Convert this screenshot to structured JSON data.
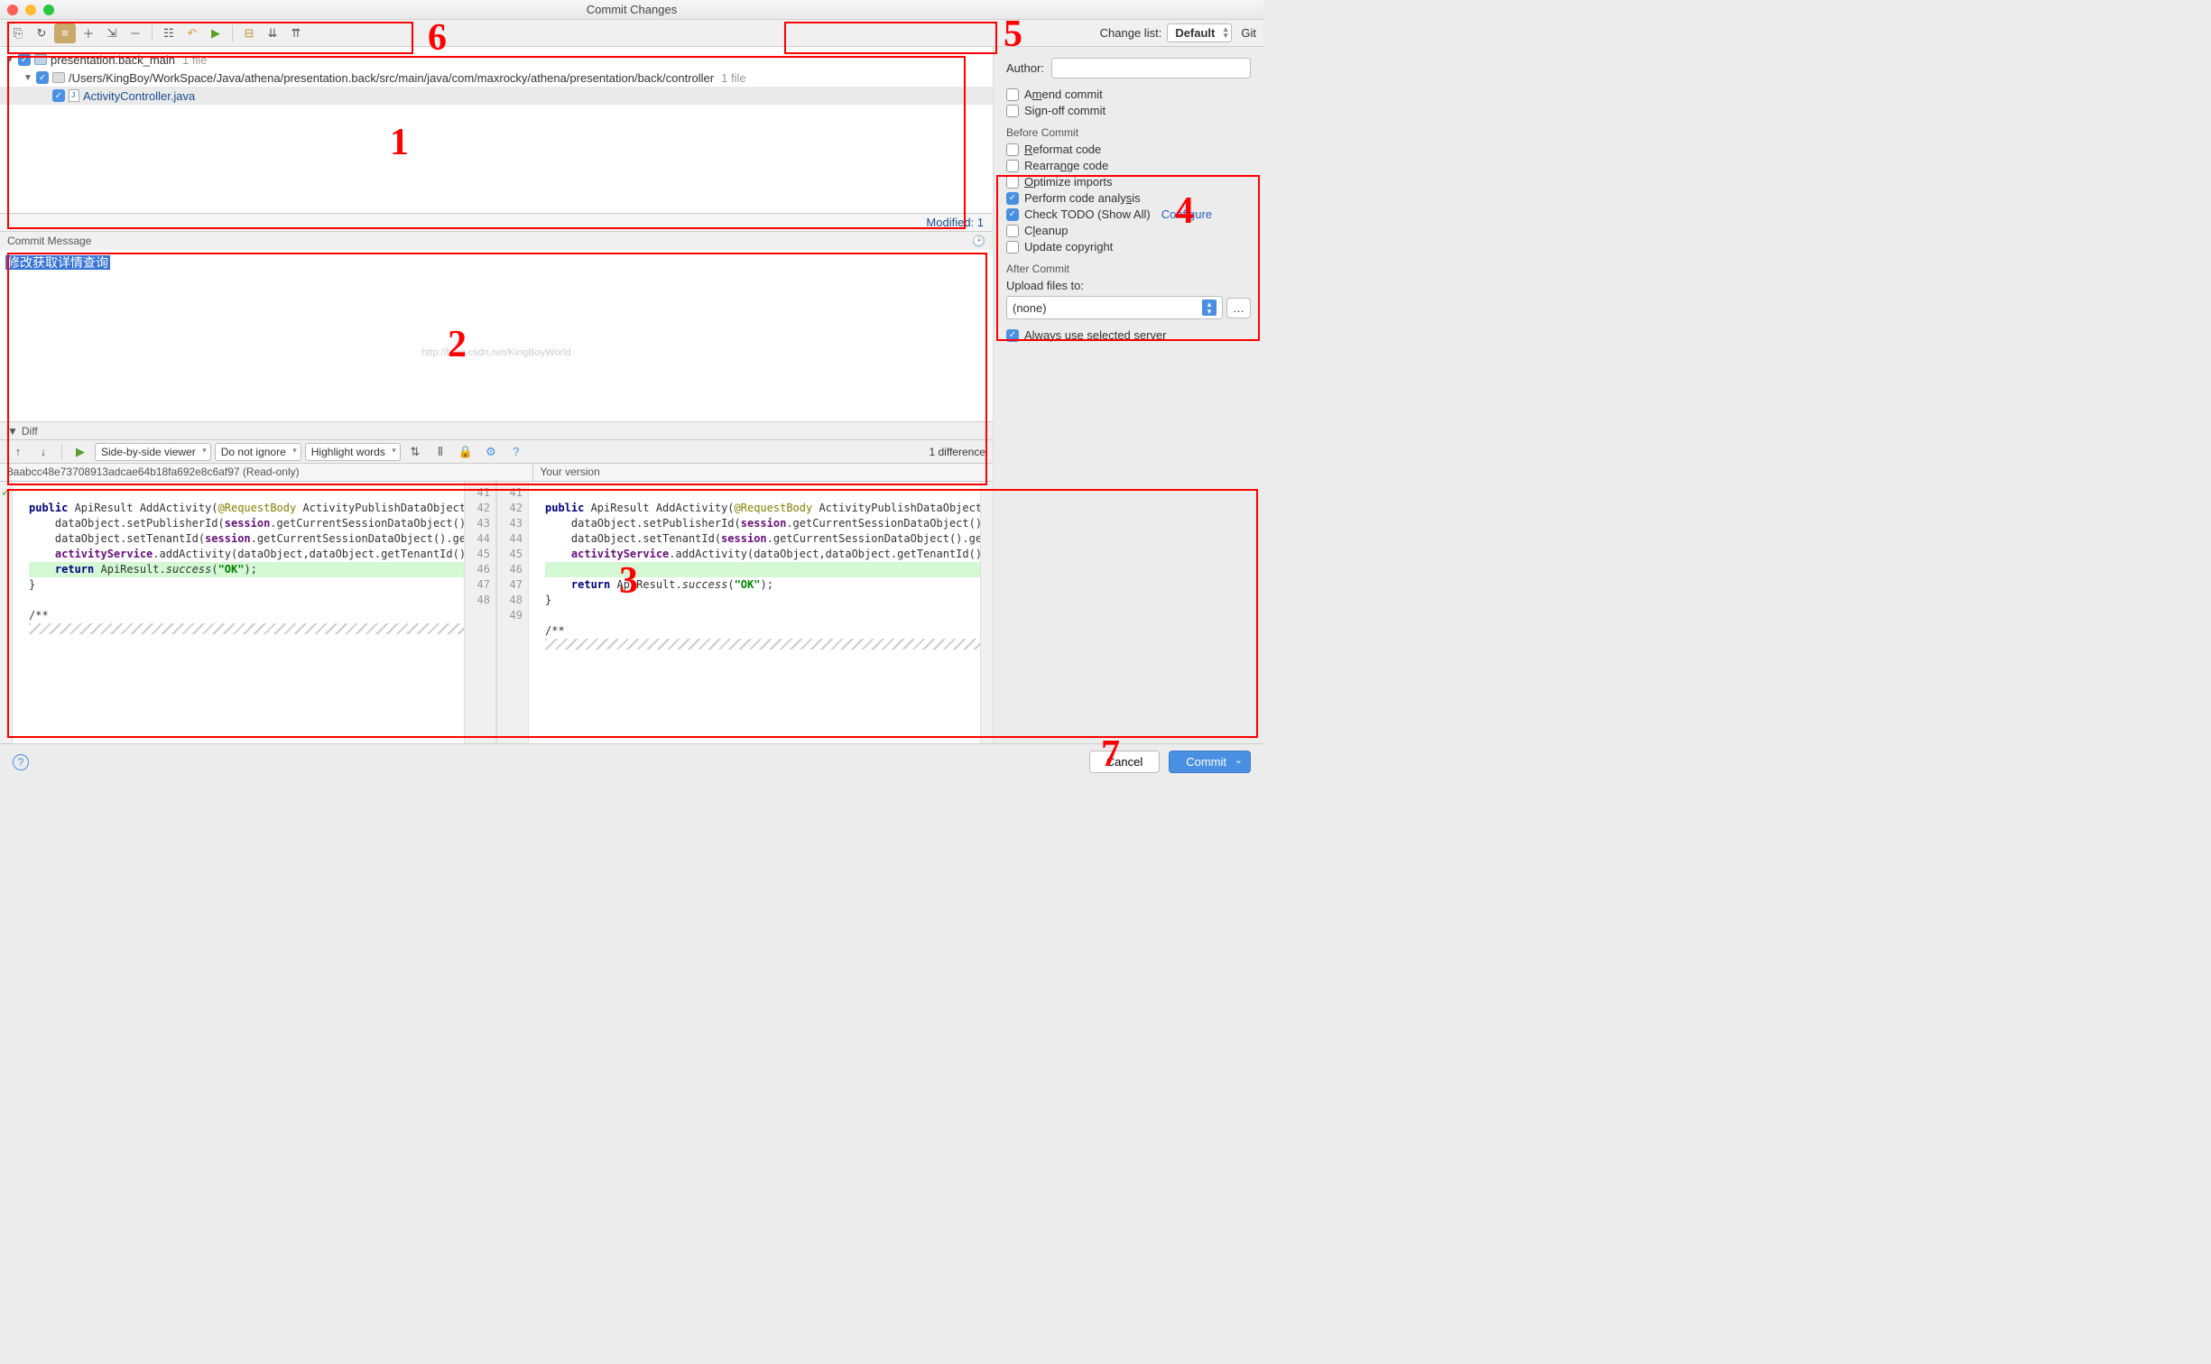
{
  "title": "Commit Changes",
  "changeList": {
    "label": "Change list:",
    "value": "Default",
    "vcs": "Git"
  },
  "tree": {
    "root": {
      "label": "presentation.back_main",
      "count": "1 file"
    },
    "path": {
      "label": "/Users/KingBoy/WorkSpace/Java/athena/presentation.back/src/main/java/com/maxrocky/athena/presentation/back/controller",
      "count": "1 file"
    },
    "file": {
      "label": "ActivityController.java"
    }
  },
  "modified": "Modified: 1",
  "commitMsg": {
    "header": "Commit Message",
    "text": "修改获取详情查询"
  },
  "watermark": "http://blog.csdn.net/KingBoyWorld",
  "diffHeader": "Diff",
  "diffToolbar": {
    "viewer": "Side-by-side viewer",
    "ignore": "Do not ignore",
    "highlight": "Highlight words"
  },
  "diffCount": "1 difference",
  "diffTitles": {
    "left": "8aabcc48e73708913adcae64b18fa692e8c6af97 (Read-only)",
    "right": "Your version"
  },
  "gutterLeft": [
    "41",
    "42",
    "43",
    "44",
    "45",
    "46",
    "47",
    "48"
  ],
  "gutterRight": [
    "41",
    "42",
    "43",
    "44",
    "45",
    "46",
    "47",
    "48",
    "49"
  ],
  "author": {
    "label": "Author:",
    "amend": "Amend commit",
    "signoff": "Sign-off commit"
  },
  "before": {
    "title": "Before Commit",
    "reformat": "Reformat code",
    "rearrange": "Rearrange code",
    "optimize": "Optimize imports",
    "analysis": "Perform code analysis",
    "todo": "Check TODO (Show All)",
    "configure": "Configure",
    "cleanup": "Cleanup",
    "copyright": "Update copyright"
  },
  "after": {
    "title": "After Commit",
    "uploadLabel": "Upload files to:",
    "uploadValue": "(none)",
    "always": "Always use selected server"
  },
  "footer": {
    "cancel": "Cancel",
    "commit": "Commit"
  },
  "annotations": {
    "n1": "1",
    "n2": "2",
    "n3": "3",
    "n4": "4",
    "n5": "5",
    "n6": "6",
    "n7": "7"
  }
}
